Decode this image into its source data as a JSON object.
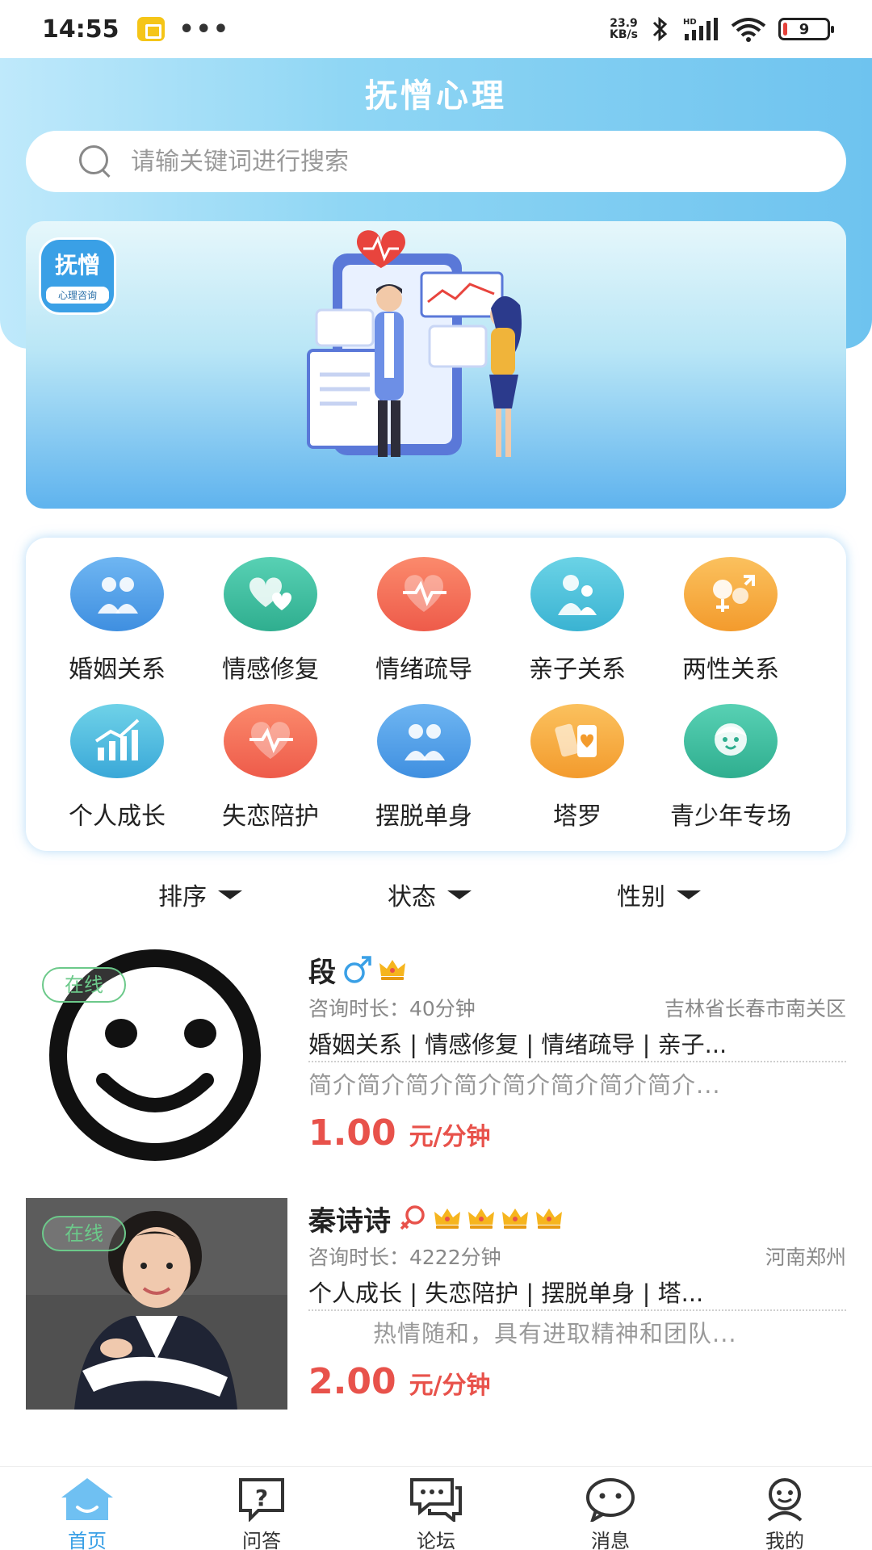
{
  "status_bar": {
    "time": "14:55",
    "dots": "•••",
    "net_speed_value": "23.9",
    "net_speed_unit": "KB/s",
    "battery": "9",
    "battery_level_percent": 9
  },
  "header": {
    "title": "抚憎心理",
    "search_placeholder": "请输关键词进行搜索"
  },
  "banner": {
    "logo_main": "抚憎",
    "logo_sub": "心理咨询"
  },
  "categories": [
    {
      "label": "婚姻关系",
      "color_from": "#6fb6f2",
      "color_to": "#3f8fe0",
      "icon": "couple-icon"
    },
    {
      "label": "情感修复",
      "color_from": "#58d1b4",
      "color_to": "#2fae8f",
      "icon": "hearts-icon"
    },
    {
      "label": "情绪疏导",
      "color_from": "#fb8a6c",
      "color_to": "#ee5b4a",
      "icon": "heartbeat-icon"
    },
    {
      "label": "亲子关系",
      "color_from": "#6bd3e6",
      "color_to": "#3ab3d2",
      "icon": "parent-child-icon"
    },
    {
      "label": "两性关系",
      "color_from": "#fbc15e",
      "color_to": "#f39b2d",
      "icon": "gender-icon"
    },
    {
      "label": "个人成长",
      "color_from": "#6fd2e8",
      "color_to": "#3aa8d8",
      "icon": "growth-chart-icon"
    },
    {
      "label": "失恋陪护",
      "color_from": "#fb8a6c",
      "color_to": "#ee5b4a",
      "icon": "heartbeat-icon"
    },
    {
      "label": "摆脱单身",
      "color_from": "#6fb6f2",
      "color_to": "#3f8fe0",
      "icon": "couple-icon"
    },
    {
      "label": "塔罗",
      "color_from": "#fbc15e",
      "color_to": "#f39b2d",
      "icon": "tarot-cards-icon"
    },
    {
      "label": "青少年专场",
      "color_from": "#58d1b4",
      "color_to": "#2fae8f",
      "icon": "child-face-icon"
    }
  ],
  "filters": {
    "sort": "排序",
    "status": "状态",
    "gender": "性别"
  },
  "counselors": [
    {
      "online": "在线",
      "name": "段",
      "crowns": 1,
      "duration": "咨询时长：40分钟",
      "location": "吉林省长春市南关区",
      "tags": "婚姻关系 | 情感修复 | 情绪疏导 | 亲子...",
      "intro": "简介简介简介简介简介简介简介简介...",
      "price": "1.00",
      "unit": "元/分钟"
    },
    {
      "online": "在线",
      "name": "秦诗诗",
      "crowns": 4,
      "duration": "咨询时长：4222分钟",
      "location": "河南郑州",
      "tags": "个人成长 | 失恋陪护 | 摆脱单身 | 塔...",
      "intro": "热情随和，具有进取精神和团队...",
      "price": "2.00",
      "unit": "元/分钟"
    }
  ],
  "nav": [
    {
      "label": "首页",
      "icon": "home-icon",
      "active": true
    },
    {
      "label": "问答",
      "icon": "question-icon",
      "active": false
    },
    {
      "label": "论坛",
      "icon": "forum-icon",
      "active": false
    },
    {
      "label": "消息",
      "icon": "message-icon",
      "active": false
    },
    {
      "label": "我的",
      "icon": "profile-icon",
      "active": false
    }
  ],
  "colors": {
    "accent": "#3aa0e6",
    "price": "#e8524b",
    "online": "#6cc98a"
  }
}
